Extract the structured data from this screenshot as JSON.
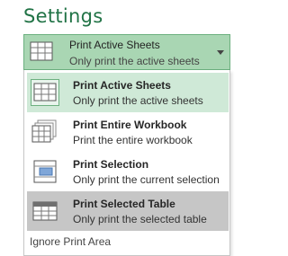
{
  "settings": {
    "heading": "Settings",
    "dropdown": {
      "title": "Print Active Sheets",
      "subtitle": "Only print the active sheets",
      "icon": "active-sheets-icon"
    },
    "menu": {
      "items": [
        {
          "title": "Print Active Sheets",
          "subtitle": "Only print the active sheets",
          "icon": "active-sheets-icon"
        },
        {
          "title": "Print Entire Workbook",
          "subtitle": "Print the entire workbook",
          "icon": "entire-workbook-icon"
        },
        {
          "title": "Print Selection",
          "subtitle": "Only print the current selection",
          "icon": "selection-icon"
        },
        {
          "title": "Print Selected Table",
          "subtitle": "Only print the selected table",
          "icon": "selected-table-icon"
        }
      ],
      "ignore_print_area": "Ignore Print Area"
    },
    "colors": {
      "accent": "#217346",
      "hover": "#cfe9d7",
      "selected": "#c6c6c6",
      "dropdown_bg": "#a9d6b3"
    }
  }
}
